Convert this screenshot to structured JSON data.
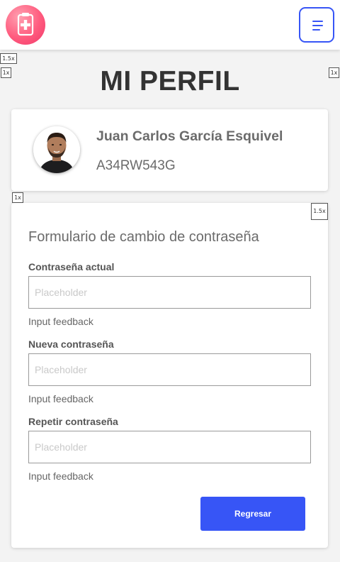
{
  "header": {
    "logo_icon": "medical-clipboard-icon",
    "menu_icon": "hamburger-menu-icon",
    "accent_color": "#3755f6"
  },
  "tags": {
    "top_left_1": "1.5x",
    "top_left_2": "1x",
    "top_right": "1x",
    "profile_below": "1x",
    "form_corner": "1.5x"
  },
  "page": {
    "title": "MI PERFIL"
  },
  "profile": {
    "name": "Juan Carlos García Esquivel",
    "id": "A34RW543G"
  },
  "form": {
    "title": "Formulario de cambio de contraseña",
    "fields": [
      {
        "label": "Contraseña actual",
        "placeholder": "Placeholder",
        "value": "",
        "feedback": "Input feedback"
      },
      {
        "label": "Nueva contraseña",
        "placeholder": "Placeholder",
        "value": "",
        "feedback": "Input feedback"
      },
      {
        "label": "Repetir contraseña",
        "placeholder": "Placeholder",
        "value": "",
        "feedback": "Input feedback"
      }
    ],
    "submit_label": "Regresar"
  }
}
